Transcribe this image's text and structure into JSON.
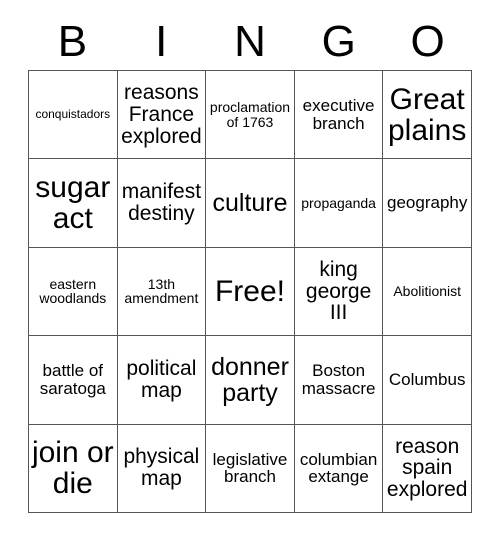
{
  "card": {
    "title": "BINGO",
    "header_letters": [
      "B",
      "I",
      "N",
      "G",
      "O"
    ],
    "free_space_text": "Free!",
    "grid_columns": 5,
    "grid_rows": 5,
    "border_color": "#555555",
    "text_color": "#000000",
    "background_color": "#ffffff",
    "cells": [
      {
        "text": "conquistadors",
        "size": "fs-xs"
      },
      {
        "text": "reasons France explored",
        "size": "fs-lg"
      },
      {
        "text": "proclamation of 1763",
        "size": "fs-sm"
      },
      {
        "text": "executive branch",
        "size": "fs-md"
      },
      {
        "text": "Great plains",
        "size": "fs-xxl"
      },
      {
        "text": "sugar act",
        "size": "fs-xxl"
      },
      {
        "text": "manifest destiny",
        "size": "fs-lg"
      },
      {
        "text": "culture",
        "size": "fs-xl"
      },
      {
        "text": "propaganda",
        "size": "fs-sm"
      },
      {
        "text": "geography",
        "size": "fs-md"
      },
      {
        "text": "eastern woodlands",
        "size": "fs-sm"
      },
      {
        "text": "13th amendment",
        "size": "fs-sm"
      },
      {
        "text": "Free!",
        "size": "fs-xxl"
      },
      {
        "text": "king george III",
        "size": "fs-lg"
      },
      {
        "text": "Abolitionist",
        "size": "fs-sm"
      },
      {
        "text": "battle of saratoga",
        "size": "fs-md"
      },
      {
        "text": "political map",
        "size": "fs-lg"
      },
      {
        "text": "donner party",
        "size": "fs-xl"
      },
      {
        "text": "Boston massacre",
        "size": "fs-md"
      },
      {
        "text": "Columbus",
        "size": "fs-md"
      },
      {
        "text": "join or die",
        "size": "fs-xxl"
      },
      {
        "text": "physical map",
        "size": "fs-lg"
      },
      {
        "text": "legislative branch",
        "size": "fs-md"
      },
      {
        "text": "columbian extange",
        "size": "fs-md"
      },
      {
        "text": "reason spain explored",
        "size": "fs-lg"
      }
    ]
  }
}
